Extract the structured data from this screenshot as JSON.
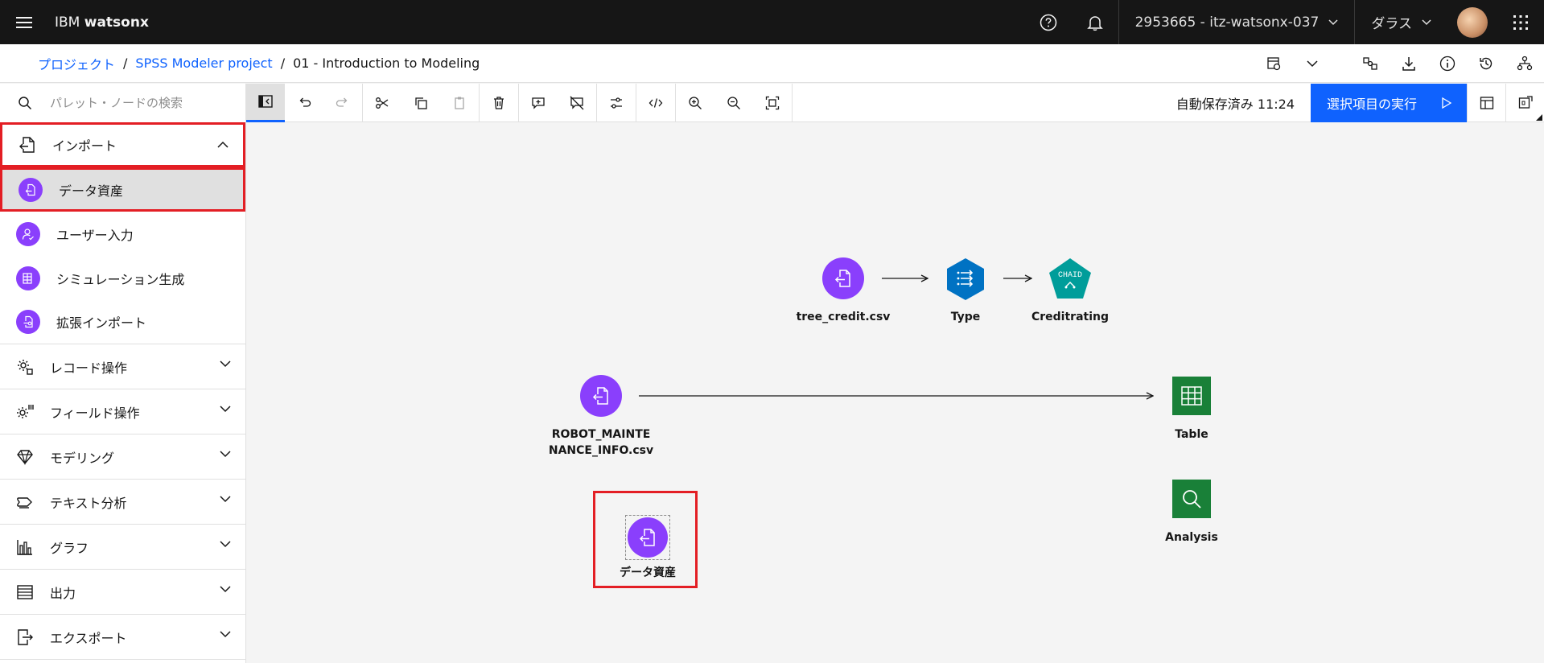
{
  "header": {
    "brand_prefix": "IBM",
    "brand_name": "watsonx",
    "account": "2953665 - itz-watsonx-037",
    "region": "ダラス"
  },
  "breadcrumb": {
    "items": [
      "プロジェクト",
      "SPSS Modeler project"
    ],
    "current": "01 - Introduction to Modeling",
    "separator": "/"
  },
  "search": {
    "placeholder": "パレット・ノードの検索"
  },
  "toolbar": {
    "autosave": "自動保存済み 11:24",
    "run_label": "選択項目の実行"
  },
  "sidebar": {
    "categories": [
      {
        "label": "インポート",
        "icon": "import-icon",
        "expanded": true
      },
      {
        "label": "レコード操作",
        "icon": "record-ops-icon"
      },
      {
        "label": "フィールド操作",
        "icon": "field-ops-icon"
      },
      {
        "label": "モデリング",
        "icon": "diamond-icon"
      },
      {
        "label": "テキスト分析",
        "icon": "text-analysis-icon"
      },
      {
        "label": "グラフ",
        "icon": "bar-chart-icon"
      },
      {
        "label": "出力",
        "icon": "list-icon"
      },
      {
        "label": "エクスポート",
        "icon": "export-icon"
      }
    ],
    "import_nodes": [
      {
        "label": "データ資産",
        "icon": "data-asset-icon",
        "selected": true
      },
      {
        "label": "ユーザー入力",
        "icon": "user-input-icon"
      },
      {
        "label": "シミュレーション生成",
        "icon": "simulation-icon"
      },
      {
        "label": "拡張インポート",
        "icon": "extension-import-icon"
      }
    ]
  },
  "canvas": {
    "nodes": [
      {
        "id": "tree_credit",
        "label": "tree_credit.csv",
        "kind": "import",
        "color": "#8a3ffc"
      },
      {
        "id": "type",
        "label": "Type",
        "kind": "type",
        "color": "#0072c3"
      },
      {
        "id": "creditrating",
        "label": "Creditrating",
        "kind": "model",
        "badge": "CHAID",
        "color": "#009d9a"
      },
      {
        "id": "robot",
        "label_line1": "ROBOT_MAINTE",
        "label_line2": "NANCE_INFO.csv",
        "kind": "import",
        "color": "#8a3ffc"
      },
      {
        "id": "table",
        "label": "Table",
        "kind": "output",
        "color": "#198038"
      },
      {
        "id": "analysis",
        "label": "Analysis",
        "kind": "output",
        "color": "#198038"
      },
      {
        "id": "new_data_asset",
        "label": "データ資産",
        "kind": "import",
        "color": "#8a3ffc"
      }
    ]
  },
  "colors": {
    "primary": "#0f62fe",
    "highlight": "#e31e24",
    "header_bg": "#161616"
  }
}
